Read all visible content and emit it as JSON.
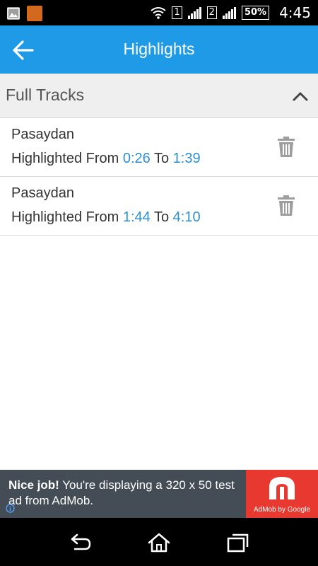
{
  "status_bar": {
    "sim1": "1",
    "sim2": "2",
    "battery": "50%",
    "time": "4:45",
    "icons": [
      "gallery-icon",
      "app-notification-icon",
      "wifi-icon",
      "signal-icon",
      "battery-icon"
    ]
  },
  "app_bar": {
    "title": "Highlights",
    "back_icon": "arrow-left-icon"
  },
  "section": {
    "title": "Full Tracks",
    "toggle_icon": "chevron-up-icon"
  },
  "highlights": [
    {
      "track": "Pasaydan",
      "prefix": "Highlighted From ",
      "from": "0:26",
      "to_label": " To ",
      "to": "1:39"
    },
    {
      "track": "Pasaydan",
      "prefix": "Highlighted From ",
      "from": "1:44",
      "to_label": " To ",
      "to": "4:10"
    }
  ],
  "ad": {
    "headline": "Nice job!",
    "body": " You're displaying a 320 x 50 test ad from AdMob.",
    "brand": "AdMob by Google"
  },
  "nav": {
    "back": "back-icon",
    "home": "home-icon",
    "recents": "recents-icon"
  },
  "colors": {
    "app_bar": "#1e9ae6",
    "time_accent": "#2d8fd4",
    "ad_bg": "#444c55",
    "ad_logo_bg": "#e7392f"
  }
}
